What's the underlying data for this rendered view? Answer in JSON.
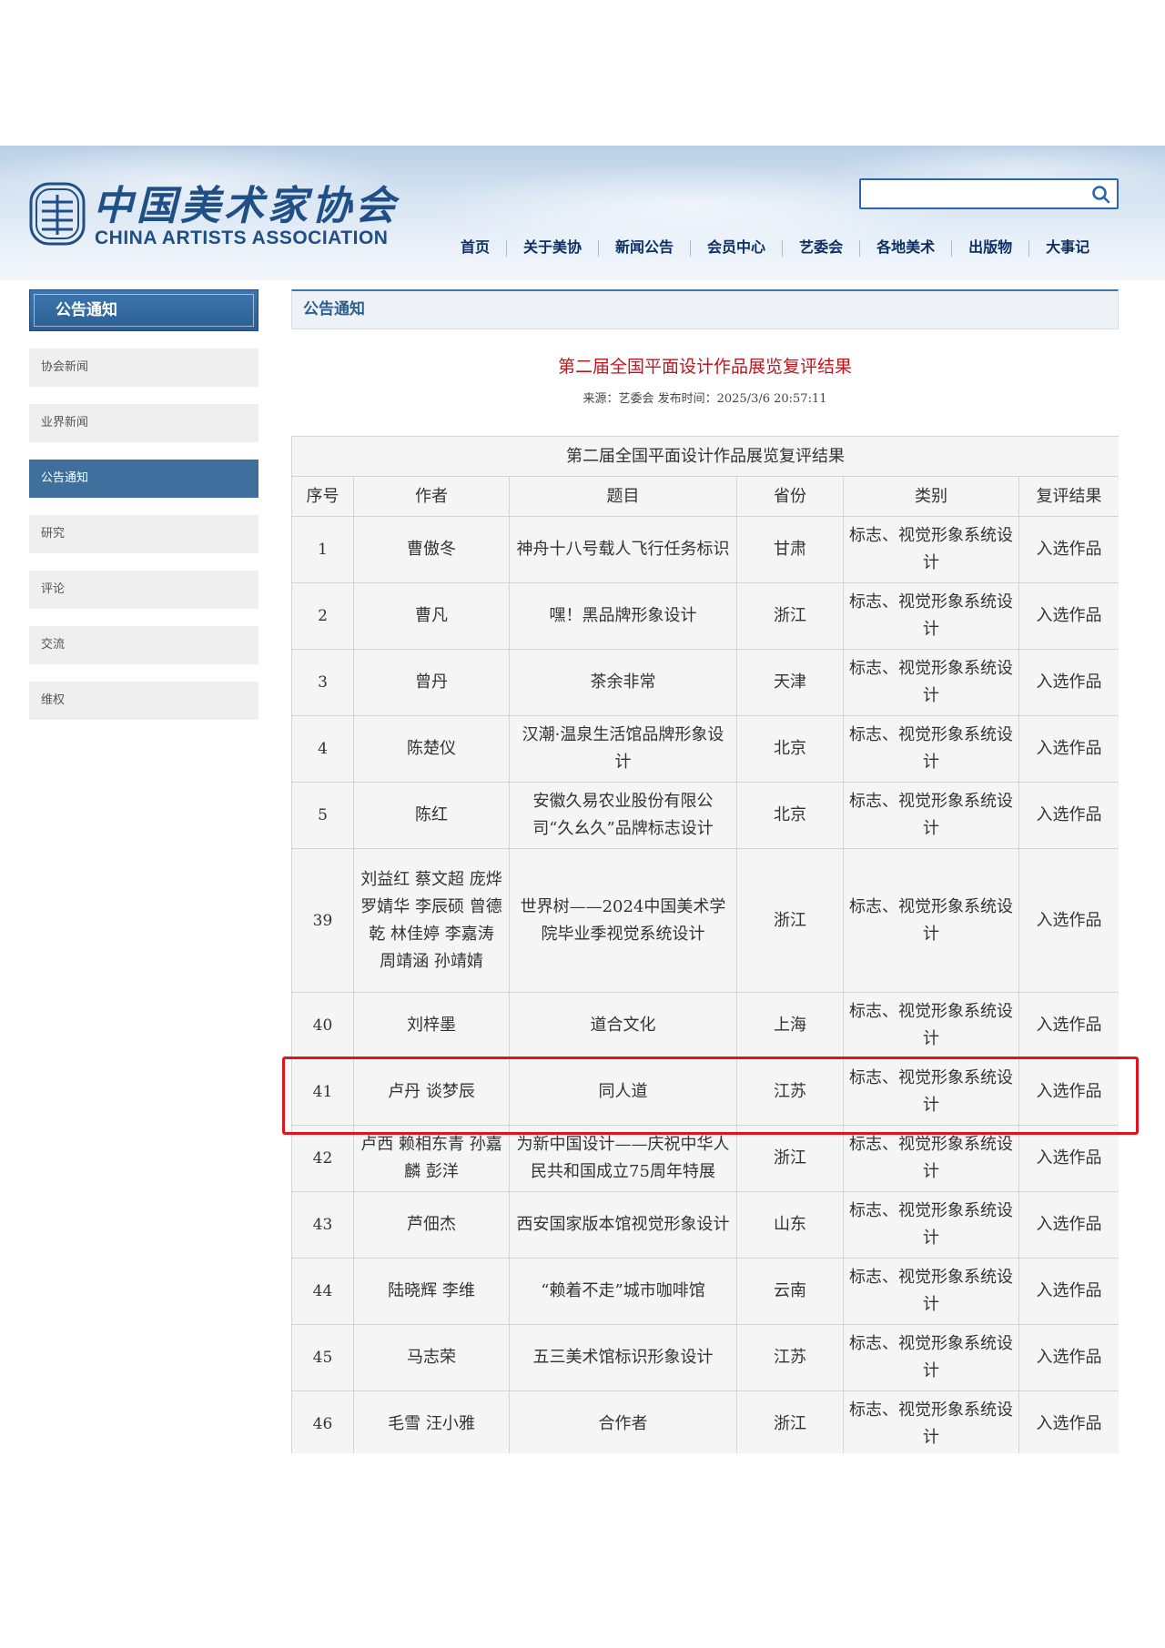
{
  "site": {
    "logo_cn": "中国美术家协会",
    "logo_en": "CHINA ARTISTS ASSOCIATION",
    "search_placeholder": "",
    "nav": [
      "首页",
      "关于美协",
      "新闻公告",
      "会员中心",
      "艺委会",
      "各地美术",
      "出版物",
      "大事记"
    ]
  },
  "sidebar": {
    "heading": "公告通知",
    "items": [
      "协会新闻",
      "业界新闻",
      "公告通知",
      "研究",
      "评论",
      "交流",
      "维权"
    ],
    "active_index": 2
  },
  "main": {
    "breadcrumb": "公告通知",
    "title": "第二届全国平面设计作品展览复评结果",
    "meta": "来源：艺委会 发布时间：2025/3/6 20:57:11"
  },
  "table": {
    "caption": "第二届全国平面设计作品展览复评结果",
    "headers": [
      "序号",
      "作者",
      "题目",
      "省份",
      "类别",
      "复评结果"
    ],
    "rows": [
      {
        "no": "1",
        "author": "曹傲冬",
        "title": "神舟十八号载人飞行任务标识",
        "province": "甘肃",
        "category": "标志、视觉形象系统设计",
        "result": "入选作品"
      },
      {
        "no": "2",
        "author": "曹凡",
        "title": "嘿！黑品牌形象设计",
        "province": "浙江",
        "category": "标志、视觉形象系统设计",
        "result": "入选作品"
      },
      {
        "no": "3",
        "author": "曾丹",
        "title": "茶余非常",
        "province": "天津",
        "category": "标志、视觉形象系统设计",
        "result": "入选作品"
      },
      {
        "no": "4",
        "author": "陈楚仪",
        "title": "汉潮·温泉生活馆品牌形象设计",
        "province": "北京",
        "category": "标志、视觉形象系统设计",
        "result": "入选作品"
      },
      {
        "no": "5",
        "author": "陈红",
        "title": "安徽久易农业股份有限公司“久幺久”品牌标志设计",
        "province": "北京",
        "category": "标志、视觉形象系统设计",
        "result": "入选作品"
      },
      {
        "no": "39",
        "author": "刘益红 蔡文超 庞烨 罗婧华 李辰硕 曾德乾 林佳婷 李嘉涛 周靖涵 孙靖婧",
        "title": "世界树——2024中国美术学院毕业季视觉系统设计",
        "province": "浙江",
        "category": "标志、视觉形象系统设计",
        "result": "入选作品"
      },
      {
        "no": "40",
        "author": "刘梓墨",
        "title": "道合文化",
        "province": "上海",
        "category": "标志、视觉形象系统设计",
        "result": "入选作品"
      },
      {
        "no": "41",
        "author": "卢丹 谈梦辰",
        "title": "同人道",
        "province": "江苏",
        "category": "标志、视觉形象系统设计",
        "result": "入选作品"
      },
      {
        "no": "42",
        "author": "卢西 赖相东青 孙嘉麟 彭洋",
        "title": "为新中国设计——庆祝中华人民共和国成立75周年特展",
        "province": "浙江",
        "category": "标志、视觉形象系统设计",
        "result": "入选作品"
      },
      {
        "no": "43",
        "author": "芦佃杰",
        "title": "西安国家版本馆视觉形象设计",
        "province": "山东",
        "category": "标志、视觉形象系统设计",
        "result": "入选作品"
      },
      {
        "no": "44",
        "author": "陆晓辉 李维",
        "title": "“赖着不走”城市咖啡馆",
        "province": "云南",
        "category": "标志、视觉形象系统设计",
        "result": "入选作品"
      },
      {
        "no": "45",
        "author": "马志荣",
        "title": "五三美术馆标识形象设计",
        "province": "江苏",
        "category": "标志、视觉形象系统设计",
        "result": "入选作品"
      },
      {
        "no": "46",
        "author": "毛雪 汪小雅",
        "title": "合作者",
        "province": "浙江",
        "category": "标志、视觉形象系统设计",
        "result": "入选作品"
      }
    ]
  },
  "colors": {
    "brand_blue": "#1f4f86",
    "title_red": "#c0151b",
    "highlight_red": "#e0141c"
  }
}
